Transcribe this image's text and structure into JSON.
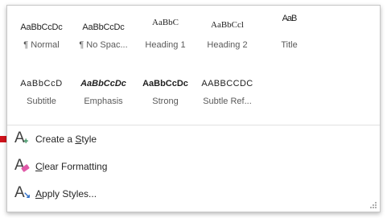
{
  "styles": [
    {
      "sample": "AaBbCcDc",
      "name": "¶ Normal"
    },
    {
      "sample": "AaBbCcDc",
      "name": "¶ No Spac..."
    },
    {
      "sample": "AaBbC",
      "name": "Heading 1"
    },
    {
      "sample": "AaBbCcl",
      "name": "Heading 2"
    },
    {
      "sample": "AaB",
      "name": "Title"
    },
    {
      "sample": "AaBbCcD",
      "name": "Subtitle"
    },
    {
      "sample": "AaBbCcDc",
      "name": "Emphasis"
    },
    {
      "sample": "AaBbCcDc",
      "name": "Strong"
    },
    {
      "sample": "AABBCCDC",
      "name": "Subtle Ref..."
    }
  ],
  "menu": {
    "create_style": {
      "prefix": "Create a ",
      "mnemonic": "S",
      "suffix": "tyle"
    },
    "clear_formatting": {
      "prefix": "",
      "mnemonic": "C",
      "suffix": "lear Formatting"
    },
    "apply_styles": {
      "prefix": "",
      "mnemonic": "A",
      "suffix": "pply Styles..."
    }
  },
  "colors": {
    "heading_blue": "#2f5597",
    "pointer_red": "#d0121b"
  },
  "icons": [
    "create-style-icon",
    "clear-formatting-icon",
    "apply-styles-icon",
    "resize-grip-icon"
  ]
}
